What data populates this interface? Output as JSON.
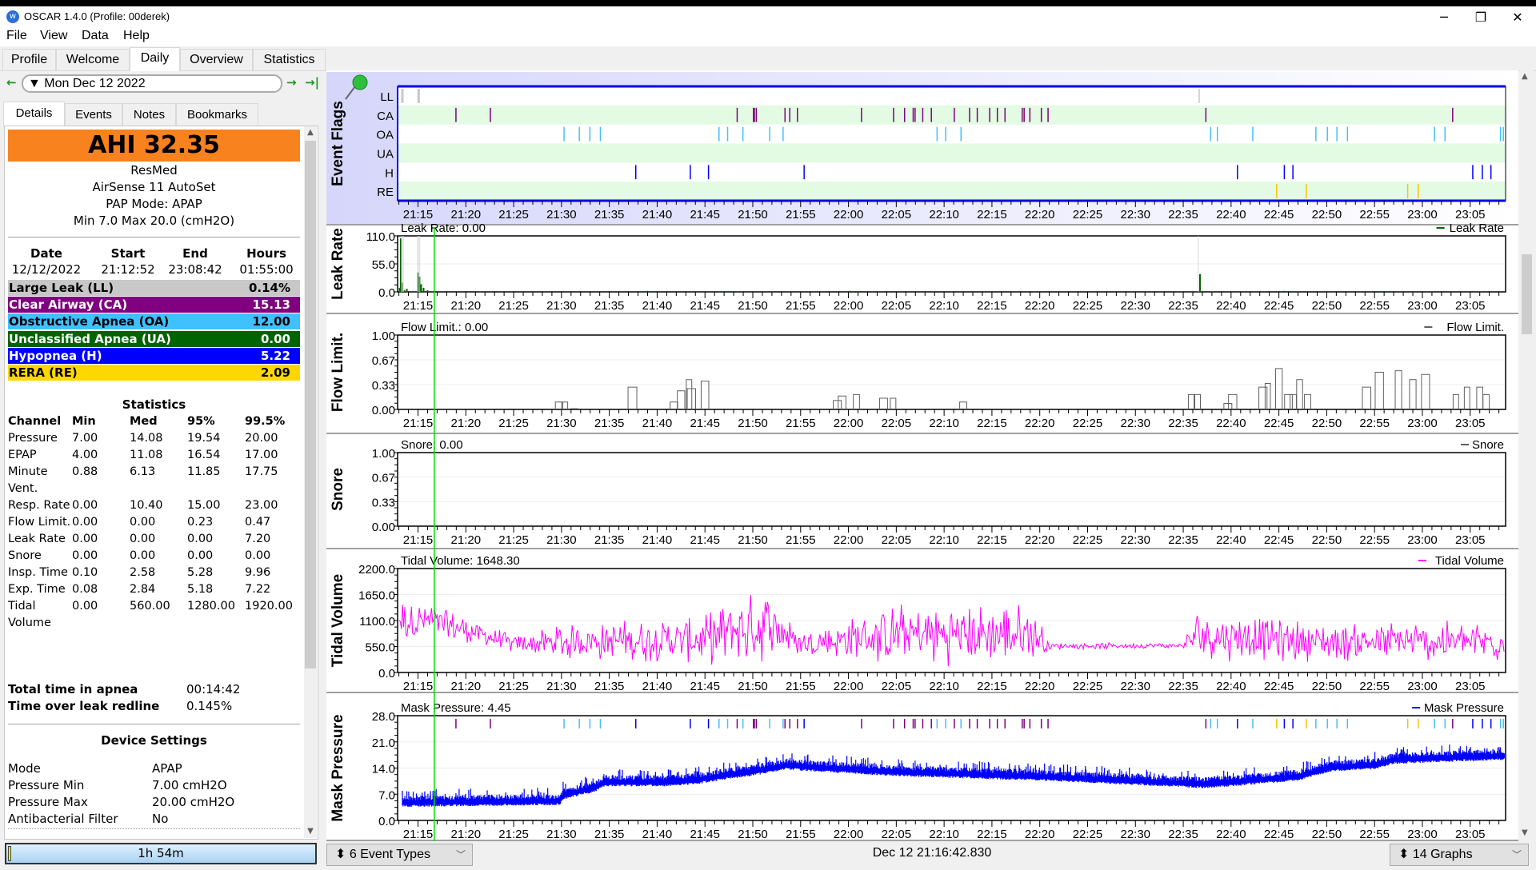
{
  "window": {
    "title": "OSCAR 1.4.0 (Profile: 00derek)",
    "app_icon": "oscar-logo-icon",
    "controls": [
      "minimize-icon",
      "restore-icon",
      "close-icon"
    ],
    "control_glyphs": [
      "─",
      "❐",
      "✕"
    ]
  },
  "menu": [
    "File",
    "View",
    "Data",
    "Help"
  ],
  "tabs": [
    "Profile",
    "Welcome",
    "Daily",
    "Overview",
    "Statistics"
  ],
  "active_tab": "Daily",
  "date_nav": {
    "date": "Mon Dec 12 2022",
    "prev_glyph": "←",
    "next_glyph": "→",
    "last_glyph": "→|"
  },
  "sub_tabs": [
    "Details",
    "Events",
    "Notes",
    "Bookmarks"
  ],
  "active_sub_tab": "Details",
  "details": {
    "ahi": "AHI 32.35",
    "ahi_color": "#f7821e",
    "brand": "ResMed",
    "model": "AirSense 11 AutoSet",
    "pap_mode": "PAP Mode: APAP",
    "pressure_range": "Min 7.0 Max 20.0 (cmH2O)",
    "session_headers": [
      "Date",
      "Start",
      "End",
      "Hours"
    ],
    "session": [
      "12/12/2022",
      "21:12:52",
      "23:08:42",
      "01:55:00"
    ],
    "indices": [
      {
        "label": "Large Leak (LL)",
        "value": "0.14%",
        "color": "#c8c8c8",
        "text": "#000000"
      },
      {
        "label": "Clear Airway (CA)",
        "value": "15.13",
        "color": "#800080",
        "text": "#ffffff"
      },
      {
        "label": "Obstructive Apnea (OA)",
        "value": "12.00",
        "color": "#40c0ff",
        "text": "#000000"
      },
      {
        "label": "Unclassified Apnea (UA)",
        "value": "0.00",
        "color": "#006400",
        "text": "#ffffff"
      },
      {
        "label": "Hypopnea (H)",
        "value": "5.22",
        "color": "#0000ff",
        "text": "#ffffff"
      },
      {
        "label": "RERA (RE)",
        "value": "2.09",
        "color": "#ffd700",
        "text": "#000000"
      }
    ],
    "statistics": {
      "title": "Statistics",
      "headers": [
        "Channel",
        "Min",
        "Med",
        "95%",
        "99.5%"
      ],
      "rows": [
        [
          "Pressure",
          "7.00",
          "14.08",
          "19.54",
          "20.00"
        ],
        [
          "EPAP",
          "4.00",
          "11.08",
          "16.54",
          "17.00"
        ],
        [
          "Minute Vent.",
          "0.88",
          "6.13",
          "11.85",
          "17.75"
        ],
        [
          "Resp. Rate",
          "0.00",
          "10.40",
          "15.00",
          "23.00"
        ],
        [
          "Flow Limit.",
          "0.00",
          "0.00",
          "0.23",
          "0.47"
        ],
        [
          "Leak Rate",
          "0.00",
          "0.00",
          "0.00",
          "7.20"
        ],
        [
          "Snore",
          "0.00",
          "0.00",
          "0.00",
          "0.00"
        ],
        [
          "Insp. Time",
          "0.10",
          "2.58",
          "5.28",
          "9.96"
        ],
        [
          "Exp. Time",
          "0.08",
          "2.84",
          "5.18",
          "7.22"
        ],
        [
          "Tidal Volume",
          "0.00",
          "560.00",
          "1280.00",
          "1920.00"
        ]
      ]
    },
    "totals": [
      {
        "label": "Total time in apnea",
        "value": "00:14:42"
      },
      {
        "label": "Time over leak redline",
        "value": "0.145%"
      }
    ],
    "device_settings": {
      "title": "Device Settings",
      "rows": [
        {
          "label": "Mode",
          "value": "APAP"
        },
        {
          "label": "Pressure Min",
          "value": "7.00 cmH2O"
        },
        {
          "label": "Pressure Max",
          "value": "20.00 cmH2O"
        },
        {
          "label": "Antibacterial Filter",
          "value": "No"
        }
      ]
    }
  },
  "duration_bar": "1h 54m",
  "bottom": {
    "event_types": "6 Event Types",
    "cursor_time": "Dec 12 21:16:42.830",
    "graphs": "14 Graphs"
  },
  "chart_data": [
    {
      "type": "event-flags",
      "ylabel": "Event Flags",
      "icon": "pushpin-icon",
      "x_range": [
        "21:12:52",
        "23:08:42"
      ],
      "x_ticks": [
        "21:15",
        "21:20",
        "21:25",
        "21:30",
        "21:35",
        "21:40",
        "21:45",
        "21:50",
        "21:55",
        "22:00",
        "22:05",
        "22:10",
        "22:15",
        "22:20",
        "22:25",
        "22:30",
        "22:35",
        "22:40",
        "22:45",
        "22:50",
        "22:55",
        "23:00",
        "23:05"
      ],
      "rows": [
        {
          "name": "LL",
          "color": "#c8c8c8",
          "times": [
            "21:13:22",
            "21:15:04",
            "22:36:40"
          ]
        },
        {
          "name": "CA",
          "color": "#800080",
          "times": [
            "21:18:58",
            "21:22:34",
            "21:48:22",
            "21:50:04",
            "21:50:10",
            "21:50:22",
            "21:53:22",
            "21:53:52",
            "21:54:40",
            "22:01:22",
            "22:04:43",
            "22:05:52",
            "22:06:46",
            "22:06:58",
            "22:07:46",
            "22:08:40",
            "22:11:04",
            "22:12:40",
            "22:13:28",
            "22:14:46",
            "22:15:34",
            "22:16:22",
            "22:18:10",
            "22:18:22",
            "22:18:58",
            "22:20:10",
            "22:20:52",
            "22:37:22",
            "23:03:10"
          ]
        },
        {
          "name": "OA",
          "color": "#40c0ff",
          "times": [
            "21:30:16",
            "21:31:52",
            "21:32:58",
            "21:34:04",
            "21:46:28",
            "21:47:22",
            "21:48:58",
            "21:51:46",
            "21:53:10",
            "22:09:16",
            "22:10:10",
            "22:11:46",
            "22:37:52",
            "22:38:34",
            "22:42:16",
            "22:48:52",
            "22:50:04",
            "22:51:04",
            "22:52:10",
            "23:01:16",
            "23:02:22",
            "23:08:10",
            "23:08:28"
          ]
        },
        {
          "name": "UA",
          "color": "#006400",
          "times": []
        },
        {
          "name": "H",
          "color": "#0000ff",
          "times": [
            "21:37:46",
            "21:43:28",
            "21:45:22",
            "21:55:22",
            "22:40:40",
            "22:45:34",
            "22:46:28",
            "23:05:16",
            "23:06:16",
            "23:07:10"
          ]
        },
        {
          "name": "RE",
          "color": "#ffc000",
          "times": [
            "22:44:46",
            "22:47:52",
            "22:58:28",
            "22:59:34"
          ]
        }
      ]
    },
    {
      "type": "bar",
      "ylabel": "Leak Rate",
      "title": "Leak Rate: 0.00",
      "legend": "Leak Rate",
      "color": "#006400",
      "y_ticks": [
        "0.0",
        "55.0",
        "110.0"
      ],
      "ylim": [
        0,
        110
      ],
      "points": [
        [
          "21:13:05",
          8
        ],
        [
          "21:13:12",
          105
        ],
        [
          "21:13:20",
          18
        ],
        [
          "21:13:35",
          3
        ],
        [
          "21:13:50",
          6
        ],
        [
          "21:15:00",
          38
        ],
        [
          "21:15:10",
          30
        ],
        [
          "21:15:20",
          15
        ],
        [
          "21:15:35",
          8
        ],
        [
          "21:16:00",
          3
        ],
        [
          "21:16:40",
          1
        ],
        [
          "21:21:30",
          1
        ],
        [
          "21:39:00",
          2
        ],
        [
          "21:47:00",
          1.5
        ],
        [
          "21:52:00",
          1
        ],
        [
          "22:00:10",
          2
        ],
        [
          "22:01:00",
          1
        ],
        [
          "22:09:00",
          1
        ],
        [
          "22:19:30",
          1
        ],
        [
          "22:36:45",
          35
        ],
        [
          "22:38:00",
          1
        ],
        [
          "22:45:30",
          2
        ],
        [
          "22:47:00",
          1
        ],
        [
          "22:56:00",
          1.5
        ],
        [
          "23:01:00",
          1
        ],
        [
          "23:06:00",
          1
        ]
      ]
    },
    {
      "type": "step",
      "ylabel": "Flow Limit.",
      "title": "Flow Limit.: 0.00",
      "legend": "Flow Limit.",
      "color": "#606060",
      "y_ticks": [
        "0.00",
        "0.33",
        "0.67",
        "1.00"
      ],
      "ylim": [
        0,
        1
      ],
      "points": [
        [
          "21:29:45",
          0.1
        ],
        [
          "21:30:20",
          0.1
        ],
        [
          "21:31:20",
          0.01
        ],
        [
          "21:37:25",
          0.3
        ],
        [
          "21:41:45",
          0.1
        ],
        [
          "21:42:30",
          0.25
        ],
        [
          "21:43:20",
          0.4
        ],
        [
          "21:43:35",
          0.28
        ],
        [
          "21:45:00",
          0.38
        ],
        [
          "21:58:50",
          0.12
        ],
        [
          "21:59:20",
          0.18
        ],
        [
          "22:00:50",
          0.2
        ],
        [
          "22:03:40",
          0.15
        ],
        [
          "22:04:40",
          0.15
        ],
        [
          "22:12:00",
          0.1
        ],
        [
          "22:35:50",
          0.2
        ],
        [
          "22:36:30",
          0.2
        ],
        [
          "22:39:40",
          0.08
        ],
        [
          "22:40:10",
          0.2
        ],
        [
          "22:43:20",
          0.3
        ],
        [
          "22:43:50",
          0.35
        ],
        [
          "22:45:00",
          0.55
        ],
        [
          "22:46:00",
          0.2
        ],
        [
          "22:46:30",
          0.2
        ],
        [
          "22:47:10",
          0.4
        ],
        [
          "22:48:00",
          0.2
        ],
        [
          "22:54:10",
          0.3
        ],
        [
          "22:55:30",
          0.5
        ],
        [
          "22:57:30",
          0.52
        ],
        [
          "22:59:00",
          0.4
        ],
        [
          "23:00:20",
          0.47
        ],
        [
          "23:03:30",
          0.2
        ],
        [
          "23:04:40",
          0.3
        ],
        [
          "23:06:00",
          0.3
        ],
        [
          "23:06:40",
          0.2
        ]
      ]
    },
    {
      "type": "line",
      "ylabel": "Snore",
      "title": "Snore: 0.00",
      "legend": "Snore",
      "color": "#606060",
      "y_ticks": [
        "0.00",
        "0.33",
        "0.67",
        "1.00"
      ],
      "ylim": [
        0,
        1
      ],
      "points": []
    },
    {
      "type": "line",
      "ylabel": "Tidal Volume",
      "title": "Tidal Volume: 1648.30",
      "legend": "Tidal Volume",
      "color": "#ff00ff",
      "y_ticks": [
        "0.0",
        "550.0",
        "1100.0",
        "1650.0",
        "2200.0"
      ],
      "ylim": [
        0,
        2200
      ],
      "envelope": [
        [
          "21:13:00",
          1100,
          500
        ],
        [
          "21:16:00",
          1100,
          500
        ],
        [
          "21:20:00",
          900,
          350
        ],
        [
          "21:25:00",
          600,
          200
        ],
        [
          "21:30:00",
          650,
          400
        ],
        [
          "21:45:00",
          700,
          550
        ],
        [
          "21:48:00",
          900,
          800
        ],
        [
          "21:52:00",
          1000,
          800
        ],
        [
          "21:55:00",
          600,
          300
        ],
        [
          "22:00:00",
          700,
          500
        ],
        [
          "22:05:00",
          800,
          700
        ],
        [
          "22:19:30",
          800,
          700
        ],
        [
          "22:21:00",
          560,
          80
        ],
        [
          "22:35:00",
          570,
          60
        ],
        [
          "22:36:30",
          800,
          600
        ],
        [
          "22:50:00",
          650,
          450
        ],
        [
          "23:08:00",
          650,
          500
        ]
      ]
    },
    {
      "type": "line",
      "ylabel": "Mask Pressure",
      "title": "Mask Pressure: 4.45",
      "legend": "Mask Pressure",
      "color": "#0000ff",
      "y_ticks": [
        "0.0",
        "7.0",
        "14.0",
        "21.0",
        "28.0"
      ],
      "ylim": [
        0,
        28
      ],
      "envelope": [
        [
          "21:13:00",
          5
        ],
        [
          "21:29:50",
          5.5
        ],
        [
          "21:30:10",
          7
        ],
        [
          "21:33:30",
          9
        ],
        [
          "21:34:30",
          10.5
        ],
        [
          "21:41:00",
          10.5
        ],
        [
          "21:44:00",
          11
        ],
        [
          "21:47:30",
          12.5
        ],
        [
          "21:50:30",
          13.5
        ],
        [
          "21:53:30",
          15
        ],
        [
          "21:56:00",
          14.5
        ],
        [
          "22:05:00",
          13.2
        ],
        [
          "22:20:00",
          12
        ],
        [
          "22:35:30",
          10.2
        ],
        [
          "22:37:00",
          10
        ],
        [
          "22:40:00",
          10.5
        ],
        [
          "22:47:00",
          12
        ],
        [
          "22:50:30",
          14.5
        ],
        [
          "22:55:00",
          15
        ],
        [
          "22:57:00",
          16.5
        ],
        [
          "23:08:00",
          17.5
        ]
      ]
    }
  ]
}
